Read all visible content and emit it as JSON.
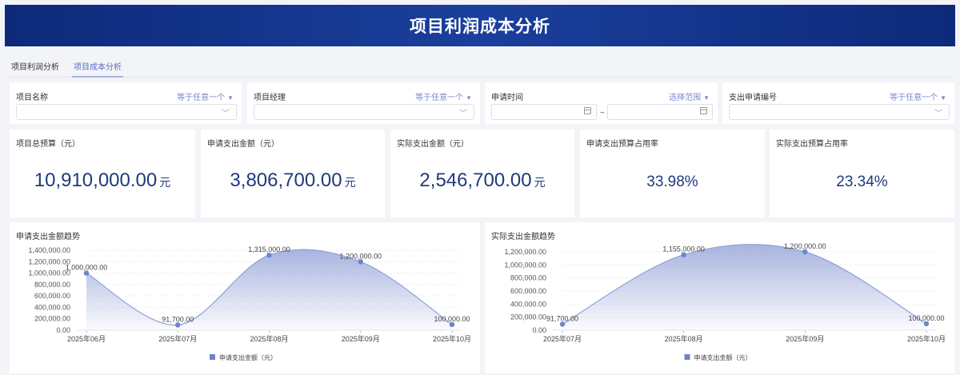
{
  "header": {
    "title": "项目利润成本分析"
  },
  "tabs": [
    {
      "label": "项目利润分析",
      "active": false
    },
    {
      "label": "项目成本分析",
      "active": true
    }
  ],
  "filters": [
    {
      "label": "项目名称",
      "operator": "等于任意一个",
      "type": "select",
      "value": ""
    },
    {
      "label": "项目经理",
      "operator": "等于任意一个",
      "type": "select",
      "value": ""
    },
    {
      "label": "申请时间",
      "operator": "选择范围",
      "type": "daterange",
      "separator": "~",
      "start": "",
      "end": ""
    },
    {
      "label": "支出申请编号",
      "operator": "等于任意一个",
      "type": "select",
      "value": ""
    }
  ],
  "kpis": [
    {
      "title": "项目总预算（元）",
      "value": "10,910,000.00",
      "unit": "元"
    },
    {
      "title": "申请支出金额（元）",
      "value": "3,806,700.00",
      "unit": "元"
    },
    {
      "title": "实际支出金额（元）",
      "value": "2,546,700.00",
      "unit": "元"
    },
    {
      "title": "申请支出预算占用率",
      "value": "33.98%",
      "unit": ""
    },
    {
      "title": "实际支出预算占用率",
      "value": "23.34%",
      "unit": ""
    }
  ],
  "colors": {
    "accent": "#5b6cc4",
    "series": "#6d84cc",
    "header": "#0d2a7a",
    "kpi_value": "#1e3a7b"
  },
  "chart_data": [
    {
      "type": "area",
      "title": "申请支出金额趋势",
      "categories": [
        "2025年06月",
        "2025年07月",
        "2025年08月",
        "2025年09月",
        "2025年10月"
      ],
      "series": [
        {
          "name": "申请支出金额（元）",
          "values": [
            1000000,
            91700,
            1315000,
            1200000,
            100000
          ],
          "labels": [
            "1,000,000.00",
            "91,700.00",
            "1,315,000.00",
            "1,200,000.00",
            "100,000.00"
          ]
        }
      ],
      "ylim": [
        0,
        1400000
      ],
      "yticks": [
        "0.00",
        "200,000.00",
        "400,000.00",
        "600,000.00",
        "800,000.00",
        "1,000,000.00",
        "1,200,000.00",
        "1,400,000.00"
      ],
      "grid": true,
      "legend": "bottom",
      "smooth": true
    },
    {
      "type": "area",
      "title": "实际支出金额趋势",
      "categories": [
        "2025年07月",
        "2025年08月",
        "2025年09月",
        "2025年10月"
      ],
      "series": [
        {
          "name": "申请支出金额（元）",
          "values": [
            91700,
            1155000,
            1200000,
            100000
          ],
          "labels": [
            "91,700.00",
            "1,155,000.00",
            "1,200,000.00",
            "100,000.00"
          ]
        }
      ],
      "ylim": [
        0,
        1200000
      ],
      "yticks": [
        "0.00",
        "200,000.00",
        "400,000.00",
        "600,000.00",
        "800,000.00",
        "1,000,000.00",
        "1,200,000.00"
      ],
      "grid": true,
      "legend": "bottom",
      "smooth": true
    }
  ]
}
